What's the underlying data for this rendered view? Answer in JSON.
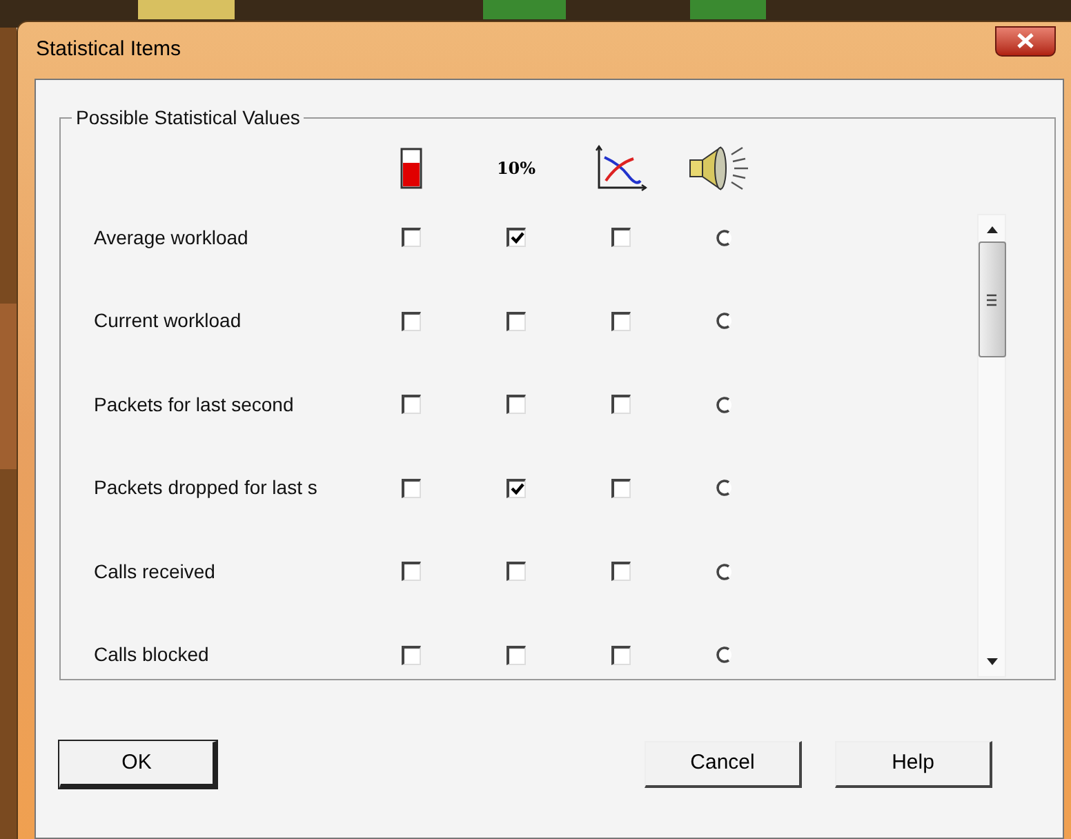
{
  "window": {
    "title": "Statistical Items"
  },
  "group": {
    "title": "Possible Statistical Values",
    "columns": [
      {
        "kind": "gauge"
      },
      {
        "kind": "text",
        "label": "10%"
      },
      {
        "kind": "chart"
      },
      {
        "kind": "speaker"
      }
    ],
    "rows": [
      {
        "label": "Average workload",
        "checks": [
          false,
          true,
          false
        ],
        "selected": false
      },
      {
        "label": "Current workload",
        "checks": [
          false,
          false,
          false
        ],
        "selected": false
      },
      {
        "label": "Packets for last second",
        "checks": [
          false,
          false,
          false
        ],
        "selected": false
      },
      {
        "label": "Packets dropped for last s",
        "checks": [
          false,
          true,
          false
        ],
        "selected": false
      },
      {
        "label": "Calls received",
        "checks": [
          false,
          false,
          false
        ],
        "selected": false
      },
      {
        "label": "Calls blocked",
        "checks": [
          false,
          false,
          false
        ],
        "selected": false
      }
    ]
  },
  "buttons": [
    {
      "label": "OK",
      "default": true
    },
    {
      "label": "Cancel",
      "default": false
    },
    {
      "label": "Help",
      "default": false
    }
  ]
}
